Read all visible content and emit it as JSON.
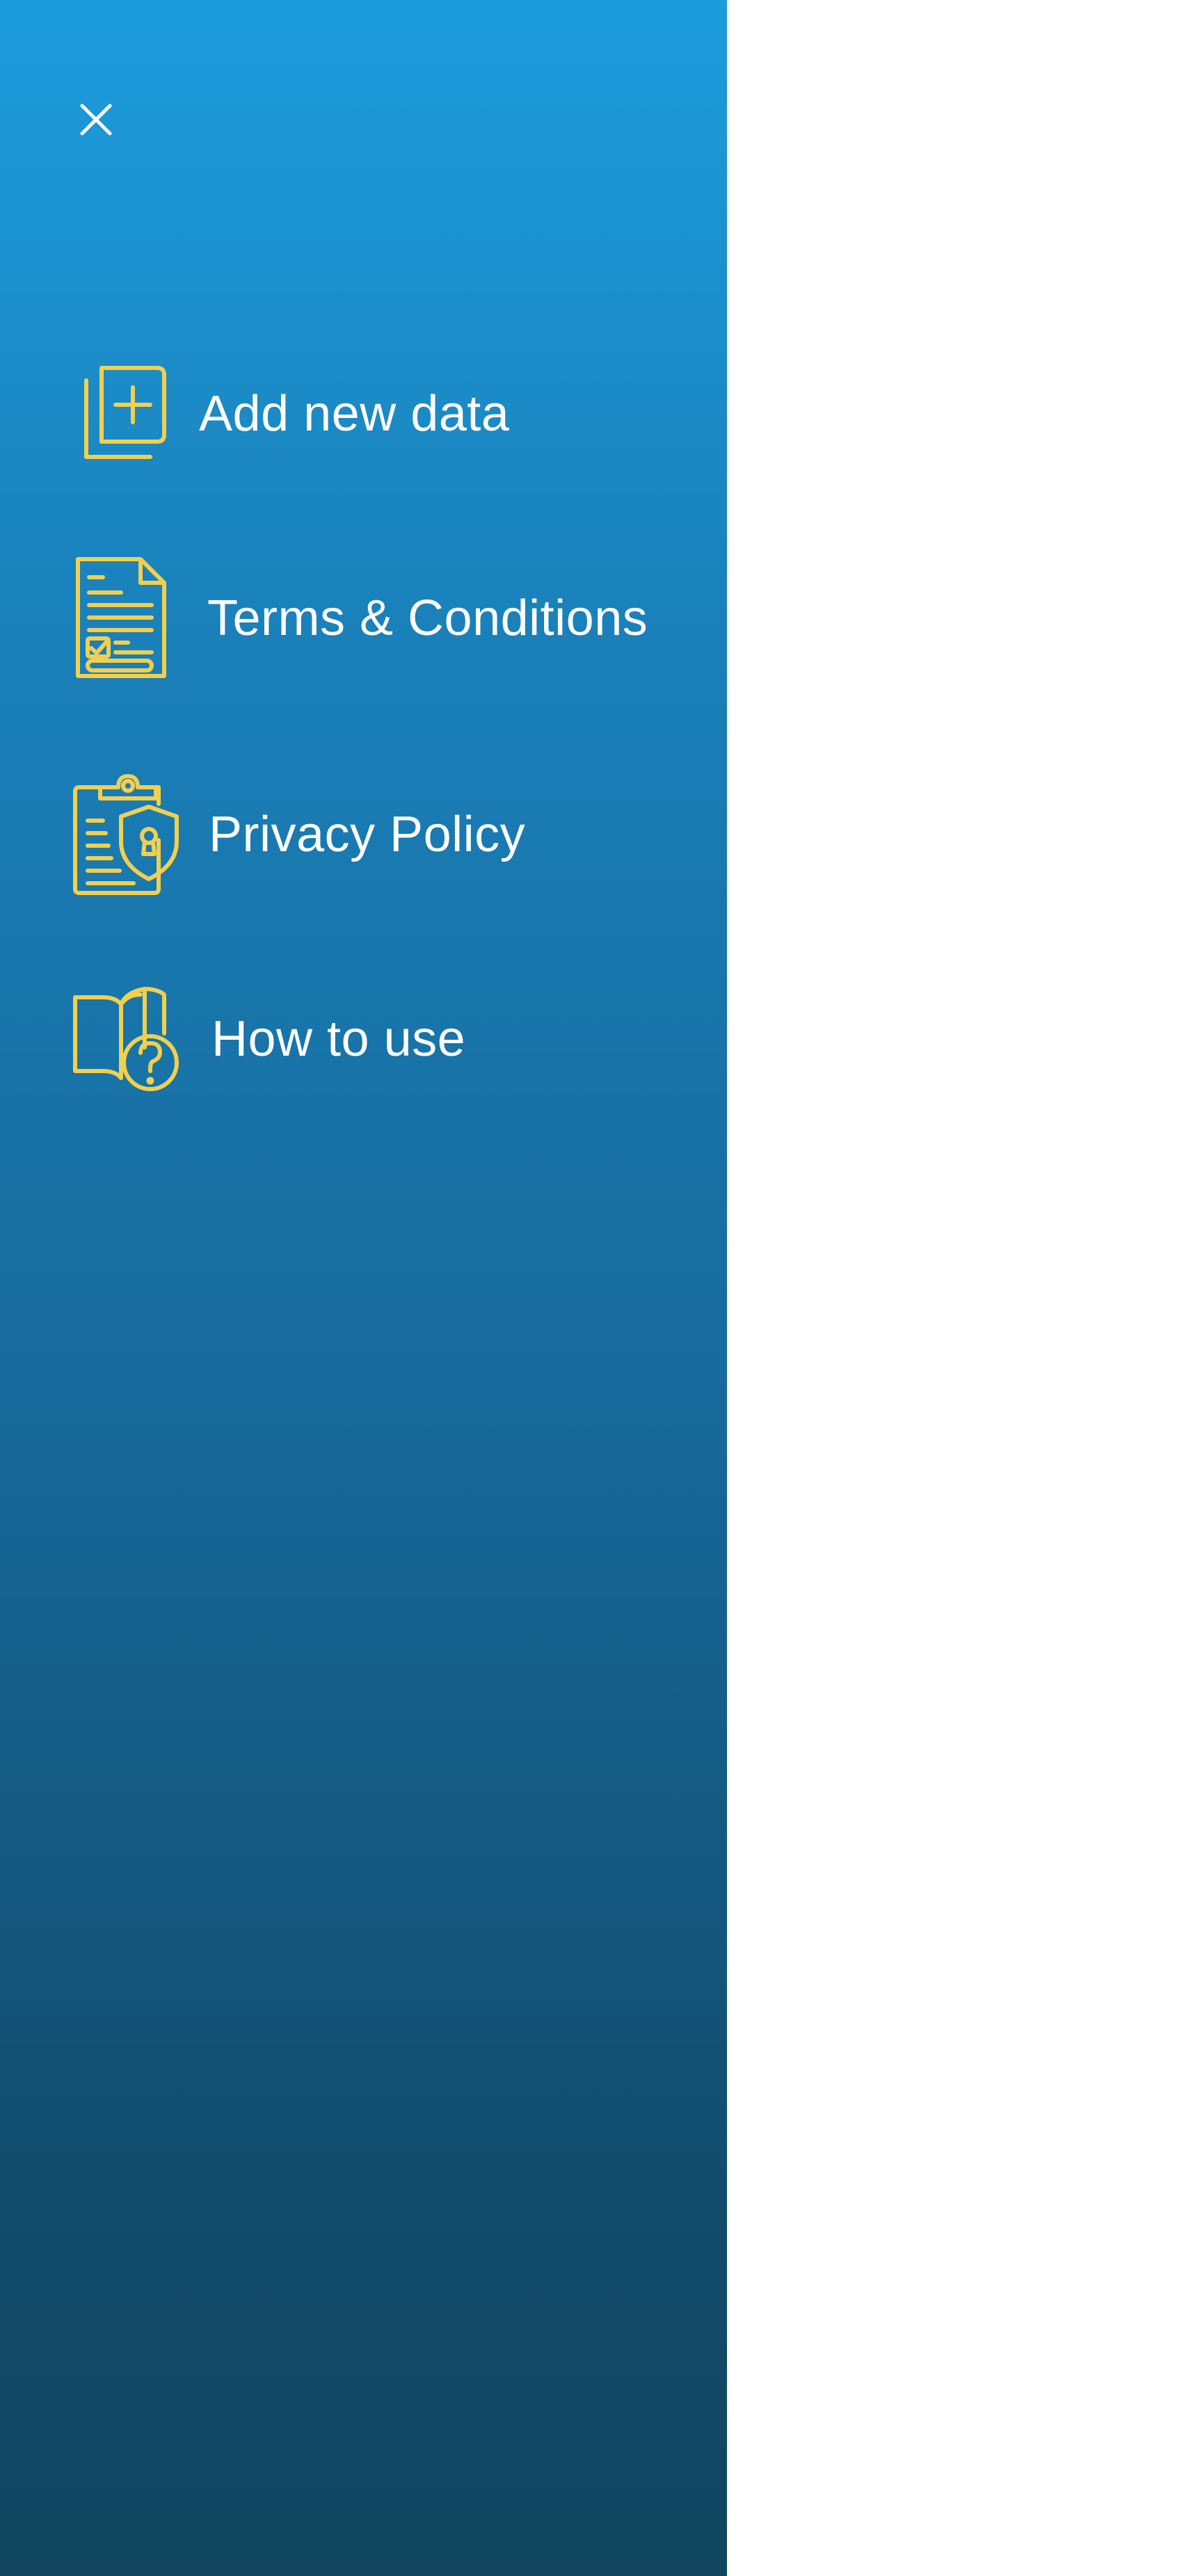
{
  "colors": {
    "drawer_top": "#1c9cdc",
    "drawer_bottom": "#11455f",
    "icon_accent": "#f2cf4e",
    "label_text": "#ffffff",
    "backdrop": "#ffffff"
  },
  "drawer": {
    "close_icon": "close-icon",
    "items": [
      {
        "label": "Add new data",
        "icon": "add-document-icon"
      },
      {
        "label": "Terms & Conditions",
        "icon": "contract-document-icon"
      },
      {
        "label": "Privacy Policy",
        "icon": "clipboard-shield-icon"
      },
      {
        "label": "How to use",
        "icon": "book-question-icon"
      }
    ]
  }
}
